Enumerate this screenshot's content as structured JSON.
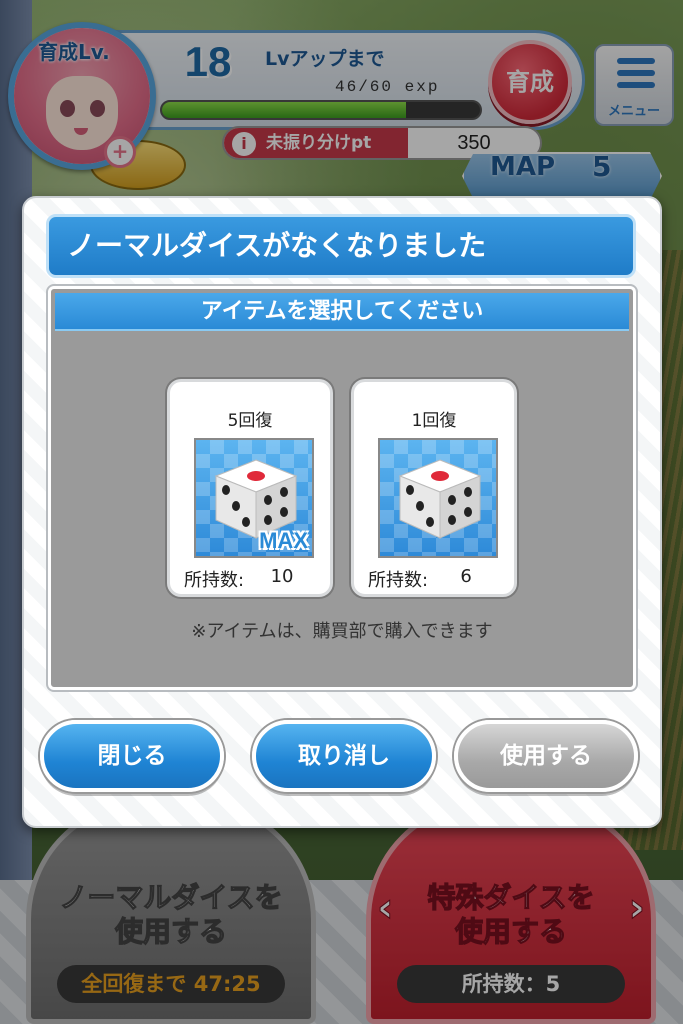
{
  "header": {
    "level_label": "育成Lv.",
    "level": "18",
    "lvup_label": "Lvアップまで",
    "exp_text": "46/60 exp",
    "exp_progress": 0.767,
    "grow_button": "育成",
    "menu_label": "メニュー",
    "unassigned_pt_label": "未振り分けpt",
    "unassigned_pt_value": "350",
    "map_label": "MAP",
    "map_number": "5"
  },
  "modal": {
    "title": "ノーマルダイスがなくなりました",
    "subtitle": "アイテムを選択してください",
    "items": [
      {
        "name": "5回復",
        "badge": "MAX",
        "count_label": "所持数:",
        "count": "10",
        "icon": "dice-icon"
      },
      {
        "name": "1回復",
        "badge": "",
        "count_label": "所持数:",
        "count": "6",
        "icon": "dice-icon"
      }
    ],
    "note": "※アイテムは、購買部で購入できます",
    "buttons": {
      "close": "閉じる",
      "cancel": "取り消し",
      "use": "使用する"
    }
  },
  "bottom": {
    "normal_dice": {
      "label": "ノーマルダイスを\n使用する",
      "footer": "全回復まで 47:25"
    },
    "special_dice": {
      "label": "特殊ダイスを\n使用する",
      "footer": "所持数：5"
    }
  },
  "colors": {
    "accent_blue": "#1f7cc8",
    "danger_red": "#c83a4a",
    "exp_green": "#3ea020"
  }
}
